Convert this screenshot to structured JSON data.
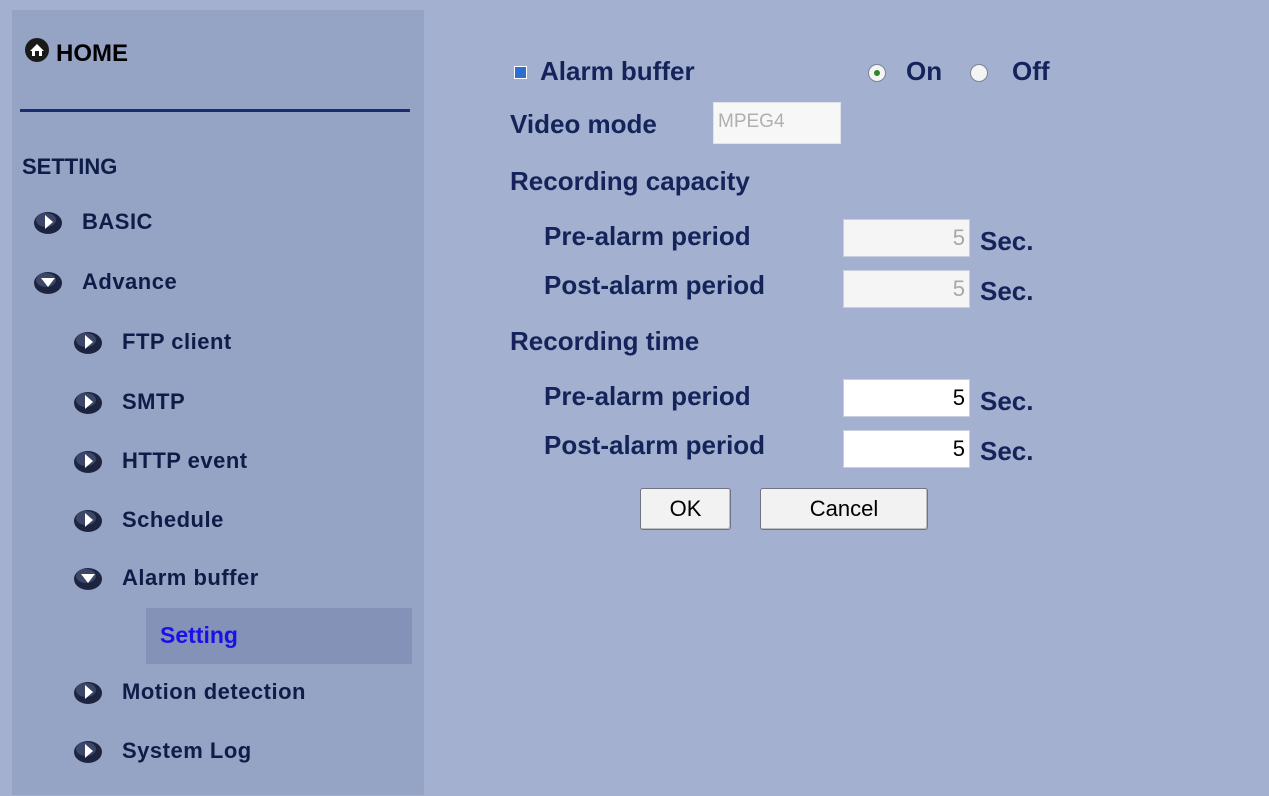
{
  "sidebar": {
    "home_label": "HOME",
    "setting_header": "SETTING",
    "items": [
      {
        "label": "BASIC",
        "state": "collapsed"
      },
      {
        "label": "Advance",
        "state": "expanded"
      },
      {
        "label": "FTP client",
        "state": "collapsed"
      },
      {
        "label": "SMTP",
        "state": "collapsed"
      },
      {
        "label": "HTTP event",
        "state": "collapsed"
      },
      {
        "label": "Schedule",
        "state": "collapsed"
      },
      {
        "label": "Alarm buffer",
        "state": "expanded"
      },
      {
        "label": "Motion detection",
        "state": "collapsed"
      },
      {
        "label": "System Log",
        "state": "collapsed"
      }
    ],
    "active_sub_label": "Setting"
  },
  "main": {
    "alarm_buffer_label": "Alarm buffer",
    "alarm_on_label": "On",
    "alarm_off_label": "Off",
    "alarm_selected": "On",
    "video_mode_label": "Video mode",
    "video_mode_value": "MPEG4",
    "recording_capacity": {
      "heading": "Recording capacity",
      "pre_label": "Pre-alarm period",
      "pre_value": "5",
      "post_label": "Post-alarm period",
      "post_value": "5",
      "unit": "Sec."
    },
    "recording_time": {
      "heading": "Recording time",
      "pre_label": "Pre-alarm period",
      "pre_value": "5",
      "post_label": "Post-alarm period",
      "post_value": "5",
      "unit": "Sec."
    },
    "ok_label": "OK",
    "cancel_label": "Cancel"
  },
  "colors": {
    "page_bg": "#a3b0cf",
    "sidebar_bg": "#95a3c4",
    "active_bg": "#8392b6",
    "active_text": "#1a10e8",
    "nav_text": "#0e1d48"
  },
  "icons": {
    "home": "home-icon",
    "collapsed": "arrow-right-icon",
    "expanded": "arrow-down-icon",
    "bullet": "square-bullet-icon"
  }
}
